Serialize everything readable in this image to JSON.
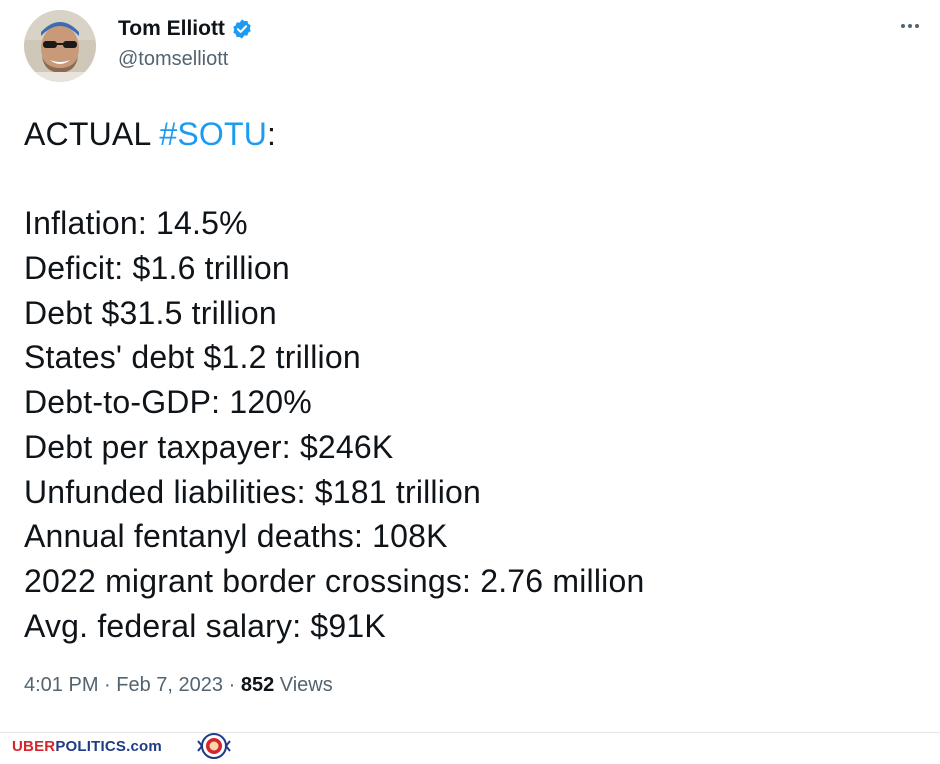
{
  "author": {
    "name": "Tom Elliott",
    "handle": "@tomselliott",
    "verified": true,
    "avatar": "profile-photo"
  },
  "menu": {
    "icon": "more-horizontal-icon"
  },
  "tweet": {
    "first_line_prefix": "ACTUAL ",
    "hashtag": "#SOTU",
    "first_line_suffix": ":",
    "lines": [
      "Inflation: 14.5%",
      "Deficit: $1.6 trillion",
      "Debt $31.5 trillion",
      "States' debt $1.2 trillion",
      "Debt-to-GDP: 120%",
      "Debt per taxpayer: $246K",
      "Unfunded liabilities: $181 trillion",
      "Annual fentanyl deaths: 108K",
      "2022 migrant border crossings: 2.76 million",
      "Avg. federal salary: $91K"
    ]
  },
  "meta": {
    "time": "4:01 PM",
    "separator": "·",
    "date": "Feb 7, 2023",
    "views_count": "852",
    "views_label": " Views"
  },
  "watermark": {
    "part1": "UBER",
    "part2": "POLITICS.com",
    "logo": "lion-crest-logo"
  },
  "colors": {
    "text": "#0f1419",
    "secondary": "#536471",
    "link": "#1d9bf0",
    "verified": "#1d9bf0",
    "brand_red": "#d5242a",
    "brand_blue": "#1f3b86"
  }
}
